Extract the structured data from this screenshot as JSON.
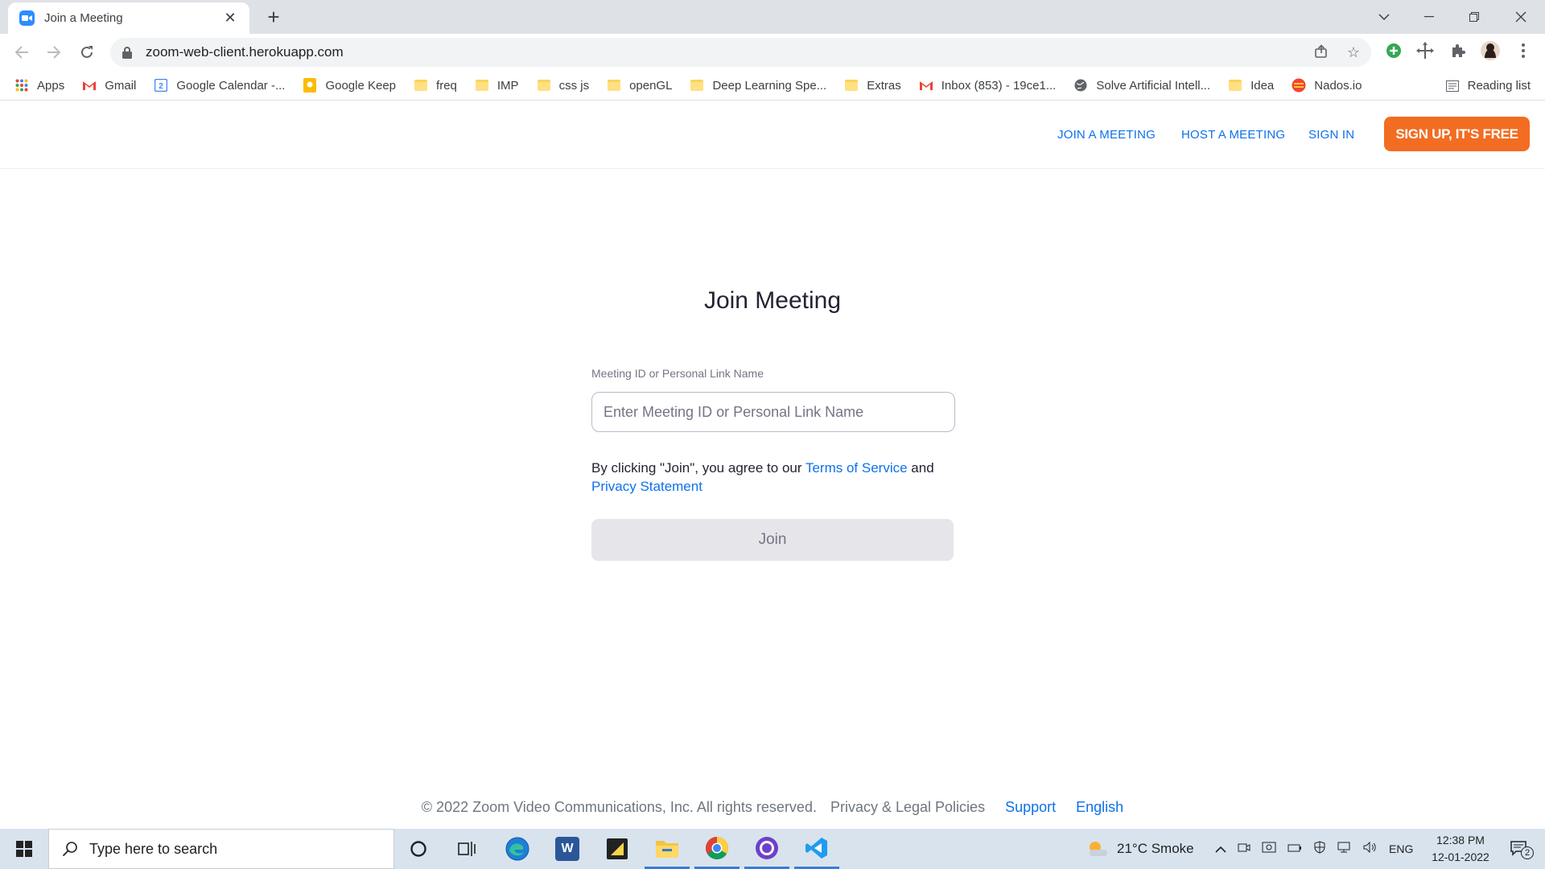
{
  "browser": {
    "tab_title": "Join a Meeting",
    "tab_close": "✕",
    "new_tab": "+",
    "url": "zoom-web-client.herokuapp.com",
    "bookmarks": [
      {
        "label": "Apps",
        "icon": "apps-grid-icon"
      },
      {
        "label": "Gmail",
        "icon": "gmail-icon"
      },
      {
        "label": "Google Calendar -...",
        "icon": "calendar-icon"
      },
      {
        "label": "Google Keep",
        "icon": "keep-icon"
      },
      {
        "label": "freq",
        "icon": "folder-icon"
      },
      {
        "label": "IMP",
        "icon": "folder-icon"
      },
      {
        "label": "css js",
        "icon": "folder-icon"
      },
      {
        "label": "openGL",
        "icon": "folder-icon"
      },
      {
        "label": "Deep Learning Spe...",
        "icon": "folder-icon"
      },
      {
        "label": "Extras",
        "icon": "folder-icon"
      },
      {
        "label": "Inbox (853) - 19ce1...",
        "icon": "gmail-icon"
      },
      {
        "label": "Solve Artificial Intell...",
        "icon": "globe-icon"
      },
      {
        "label": "Idea",
        "icon": "folder-icon"
      },
      {
        "label": "Nados.io",
        "icon": "nados-icon"
      }
    ],
    "reading_list": "Reading list"
  },
  "header": {
    "join_meeting": "JOIN A MEETING",
    "host_meeting": "HOST A MEETING",
    "sign_in": "SIGN IN",
    "sign_up": "SIGN UP, IT'S FREE"
  },
  "form": {
    "title": "Join Meeting",
    "field_label": "Meeting ID or Personal Link Name",
    "input_value": "",
    "input_placeholder": "Enter Meeting ID or Personal Link Name",
    "agree_prefix": "By clicking \"Join\", you agree to our",
    "terms_link": "Terms of Service",
    "agree_and": "and",
    "privacy_link": "Privacy Statement",
    "join_button": "Join"
  },
  "footer": {
    "copyright": "© 2022 Zoom Video Communications, Inc. All rights reserved.",
    "privacy_policies": "Privacy & Legal Policies",
    "support": "Support",
    "language": "English"
  },
  "taskbar": {
    "search_placeholder": "Type here to search",
    "weather": "21°C  Smoke",
    "language": "ENG",
    "time": "12:38 PM",
    "date": "12-01-2022",
    "notification_count": "2"
  },
  "colors": {
    "accent_blue": "#0e71eb",
    "signup_orange": "#f26d21",
    "zoom_blue": "#2d8cff"
  }
}
